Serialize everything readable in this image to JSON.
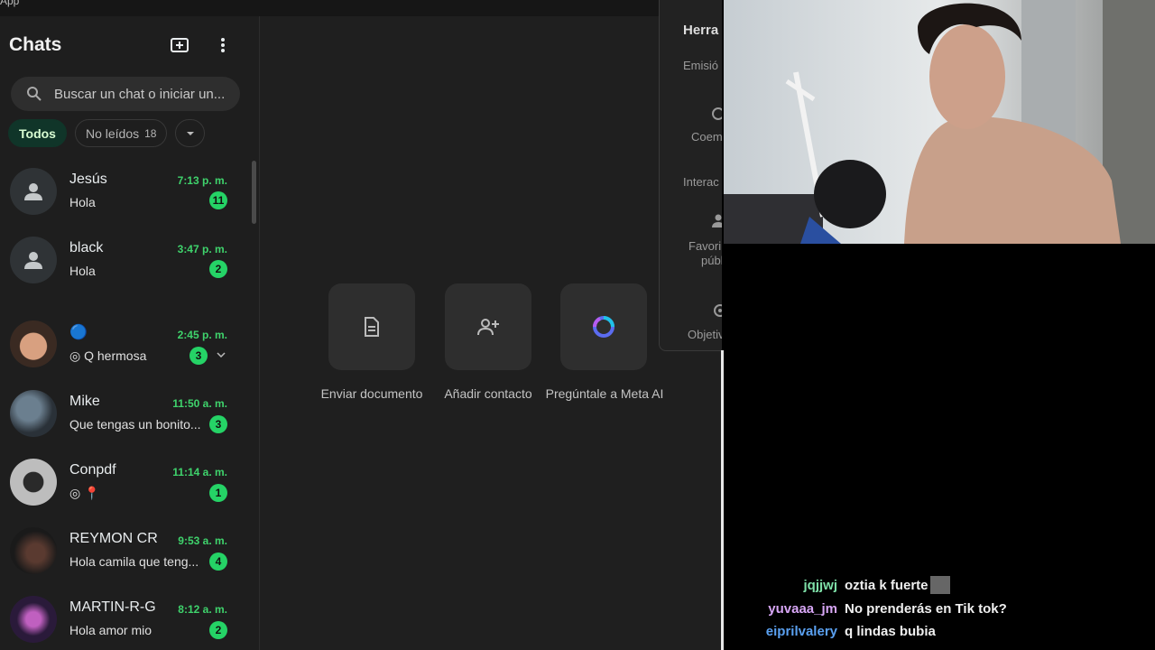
{
  "window": {
    "title": "App"
  },
  "sidebar": {
    "title": "Chats",
    "search_placeholder": "Buscar un chat o iniciar un...",
    "filters": [
      {
        "label": "Todos",
        "active": true
      },
      {
        "label": "No leídos",
        "count": "18"
      }
    ]
  },
  "chats": [
    {
      "name": "Jesús",
      "time": "7:13 p. m.",
      "preview": "Hola",
      "unread": "11",
      "avatar": "default"
    },
    {
      "name": "black",
      "time": "3:47 p. m.",
      "preview": "Hola",
      "unread": "2",
      "avatar": "default"
    },
    {
      "name": "🔵",
      "time": "2:45 p. m.",
      "preview": "Q hermosa",
      "unread": "3",
      "avatar": "photo"
    },
    {
      "name": "Mike",
      "time": "11:50 a. m.",
      "preview": "Que tengas  un bonito...",
      "unread": "3",
      "avatar": "photo"
    },
    {
      "name": "Conpdf",
      "time": "11:14 a. m.",
      "preview": "📍",
      "unread": "1",
      "avatar": "photo"
    },
    {
      "name": "REYMON CR",
      "time": "9:53 a. m.",
      "preview": "Hola camila que teng...",
      "unread": "4",
      "avatar": "photo"
    },
    {
      "name": "MARTIN-R-G",
      "time": "8:12 a. m.",
      "preview": "Hola amor mio",
      "unread": "2",
      "avatar": "photo"
    }
  ],
  "main": {
    "actions": [
      {
        "label": "Enviar documento",
        "icon": "document-icon"
      },
      {
        "label": "Añadir contacto",
        "icon": "add-contact-icon"
      },
      {
        "label": "Pregúntale a Meta AI",
        "icon": "meta-ai-icon"
      }
    ]
  },
  "tools_panel": {
    "title": "Herra",
    "items": [
      "Emisió",
      "Coem",
      "Interac",
      "Favori",
      "públ",
      "Objetiv"
    ]
  },
  "live_chat": [
    {
      "user": "jqjjwj",
      "message": "oztia k fuerte",
      "color": "#7ee0a8"
    },
    {
      "user": "yuvaaa_jm",
      "message": "No prenderás en Tik tok?",
      "color": "#d7a6f5"
    },
    {
      "user": "eiprilvalery",
      "message": "q lindas bubia",
      "color": "#5aa0f0"
    }
  ],
  "colors": {
    "accent": "#25d366",
    "active_chip_bg": "#103529"
  }
}
